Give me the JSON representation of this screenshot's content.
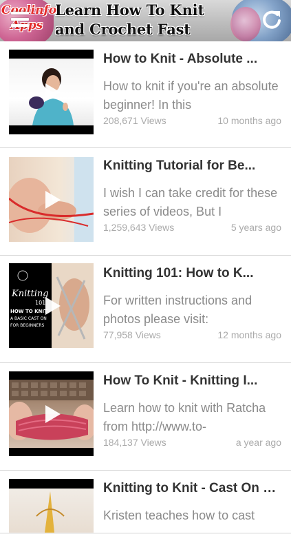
{
  "header": {
    "brand": "Coolinfo\nApps",
    "title": "Learn How To Knit\nand Crochet Fast"
  },
  "icons": {
    "menu": "menu-icon",
    "refresh": "refresh-icon",
    "play": "play-icon"
  },
  "videos": [
    {
      "title": "How to Knit - Absolute ...",
      "description": "How to knit if you're an absolute beginner! In this",
      "views": "208,671 Views",
      "age": "10 months ago"
    },
    {
      "title": "Knitting Tutorial for Be...",
      "description": "I wish I can take credit for these series of videos, But I",
      "views": "1,259,643 Views",
      "age": "5 years ago"
    },
    {
      "title": "Knitting 101: How to K...",
      "description": "For written instructions and photos please visit:",
      "views": "77,958 Views",
      "age": "12 months ago"
    },
    {
      "title": "How To Knit - Knitting I...",
      "description": "Learn how to knit with Ratcha from http://www.to-",
      "views": "184,137 Views",
      "age": "a year ago"
    },
    {
      "title": "Knitting to Knit - Cast On B...",
      "description": "Kristen teaches how to cast",
      "views": "",
      "age": ""
    }
  ],
  "thumb_text": {
    "knitting_101": "Knitting",
    "knitting_101_num": "101",
    "how_to_knit": "HOW TO KNIT",
    "basic_cast_on": "A BASIC CAST ON",
    "for_beginners": "FOR BEGINNERS"
  }
}
